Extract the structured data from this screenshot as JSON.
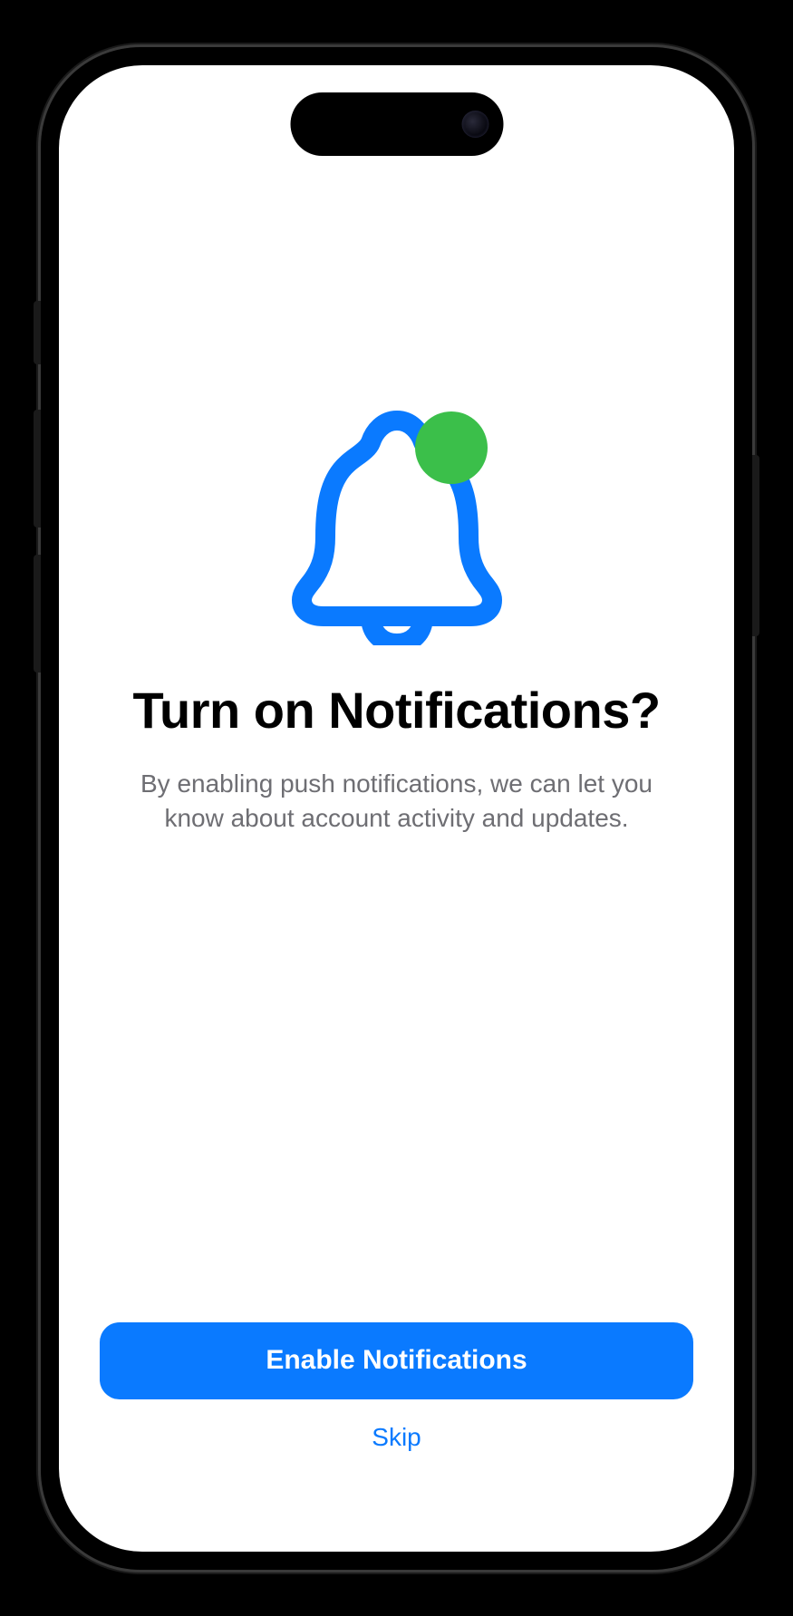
{
  "prompt": {
    "title": "Turn on Notifications?",
    "subtitle": "By enabling push notifications, we can let you know about account activity and updates."
  },
  "actions": {
    "primary_label": "Enable Notifications",
    "secondary_label": "Skip"
  },
  "colors": {
    "accent": "#0a7aff",
    "badge": "#3bbf4a"
  }
}
